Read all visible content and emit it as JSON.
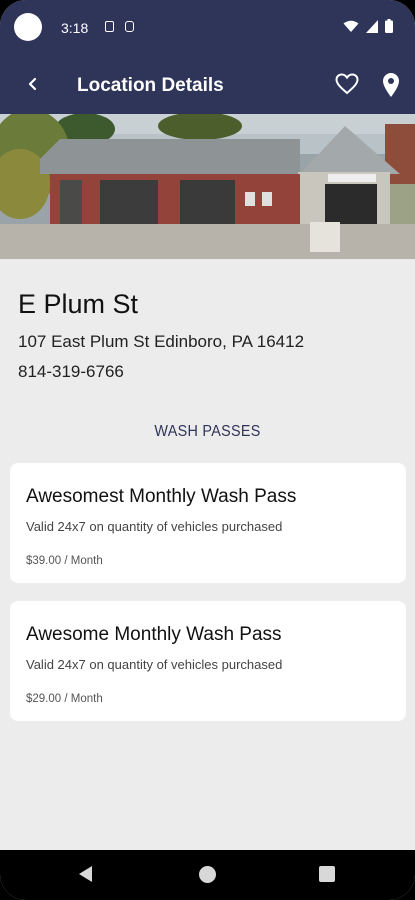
{
  "status_bar": {
    "time": "3:18",
    "icons": [
      "sim-card-icon",
      "vpn-icon",
      "wifi-icon",
      "signal-icon",
      "battery-icon"
    ]
  },
  "app_bar": {
    "title": "Location Details",
    "back_icon": "back-arrow-icon",
    "favorite_icon": "heart-icon",
    "map_icon": "location-pin-icon"
  },
  "location": {
    "name": "E Plum St",
    "address": "107 East Plum St Edinboro, PA 16412",
    "phone": "814-319-6766"
  },
  "wash_passes": {
    "heading": "WASH PASSES",
    "items": [
      {
        "title": "Awesomest Monthly Wash Pass",
        "description": "Valid 24x7 on quantity of vehicles purchased",
        "price": "$39.00 / Month"
      },
      {
        "title": "Awesome Monthly Wash Pass",
        "description": "Valid 24x7 on quantity of vehicles purchased",
        "price": "$29.00 / Month"
      }
    ]
  },
  "colors": {
    "primary": "#2f3459",
    "background": "#ececec",
    "card": "#ffffff"
  }
}
